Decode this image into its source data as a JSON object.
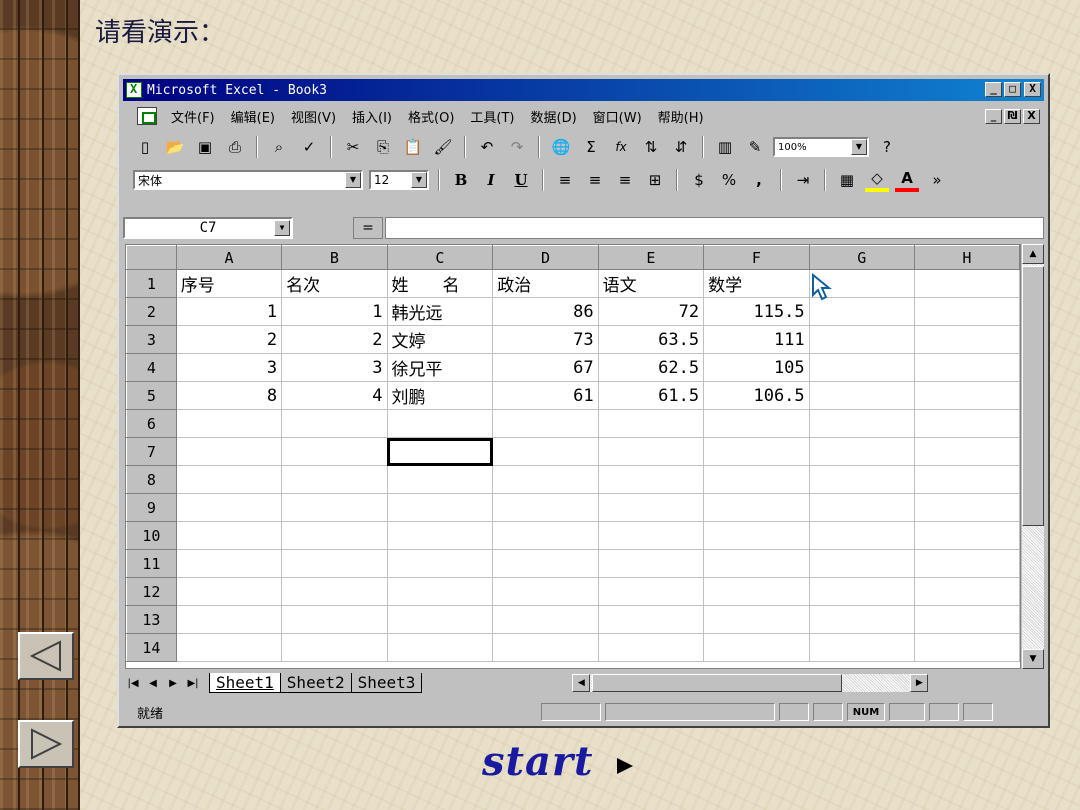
{
  "slide": {
    "heading": "请看演示：",
    "start_label": "start"
  },
  "window": {
    "title": "Microsoft Excel - Book3",
    "controls": {
      "minimize": "_",
      "maximize": "□",
      "close": "X",
      "doc_minimize": "_",
      "doc_restore": "₪",
      "doc_close": "X"
    }
  },
  "menu": [
    "文件(F)",
    "编辑(E)",
    "视图(V)",
    "插入(I)",
    "格式(O)",
    "工具(T)",
    "数据(D)",
    "窗口(W)",
    "帮助(H)"
  ],
  "toolbar": {
    "zoom": "100%",
    "font_name": "宋体",
    "font_size": "12",
    "bold": "B",
    "italic": "I",
    "underline": "U",
    "percent": "%",
    "comma": ",",
    "sum": "Σ",
    "fx": "fx"
  },
  "formula_bar": {
    "name_box": "C7",
    "equals": "="
  },
  "columns": [
    "A",
    "B",
    "C",
    "D",
    "E",
    "F",
    "G",
    "H"
  ],
  "rows": [
    {
      "n": "1",
      "cells": [
        "序号",
        "名次",
        "姓　　名",
        "政治",
        "语文",
        "数学",
        "",
        ""
      ]
    },
    {
      "n": "2",
      "cells": [
        "1",
        "1",
        "韩光远",
        "86",
        "72",
        "115.5",
        "",
        ""
      ]
    },
    {
      "n": "3",
      "cells": [
        "2",
        "2",
        "文婷",
        "73",
        "63.5",
        "111",
        "",
        ""
      ]
    },
    {
      "n": "4",
      "cells": [
        "3",
        "3",
        "徐兄平",
        "67",
        "62.5",
        "105",
        "",
        ""
      ]
    },
    {
      "n": "5",
      "cells": [
        "8",
        "4",
        "刘鹏",
        "61",
        "61.5",
        "106.5",
        "",
        ""
      ]
    },
    {
      "n": "6",
      "cells": [
        "",
        "",
        "",
        "",
        "",
        "",
        "",
        ""
      ]
    },
    {
      "n": "7",
      "cells": [
        "",
        "",
        "",
        "",
        "",
        "",
        "",
        ""
      ]
    },
    {
      "n": "8",
      "cells": [
        "",
        "",
        "",
        "",
        "",
        "",
        "",
        ""
      ]
    },
    {
      "n": "9",
      "cells": [
        "",
        "",
        "",
        "",
        "",
        "",
        "",
        ""
      ]
    },
    {
      "n": "10",
      "cells": [
        "",
        "",
        "",
        "",
        "",
        "",
        "",
        ""
      ]
    },
    {
      "n": "11",
      "cells": [
        "",
        "",
        "",
        "",
        "",
        "",
        "",
        ""
      ]
    },
    {
      "n": "12",
      "cells": [
        "",
        "",
        "",
        "",
        "",
        "",
        "",
        ""
      ]
    },
    {
      "n": "13",
      "cells": [
        "",
        "",
        "",
        "",
        "",
        "",
        "",
        ""
      ]
    },
    {
      "n": "14",
      "cells": [
        "",
        "",
        "",
        "",
        "",
        "",
        "",
        ""
      ]
    }
  ],
  "sheets": [
    "Sheet1",
    "Sheet2",
    "Sheet3"
  ],
  "status": {
    "ready": "就绪",
    "numlock": "NUM"
  }
}
